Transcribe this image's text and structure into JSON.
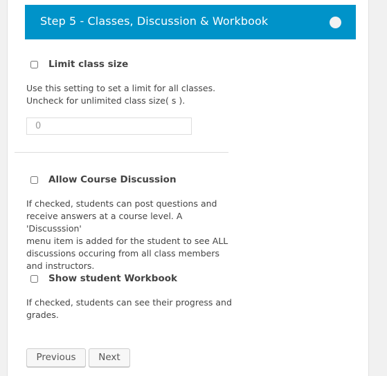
{
  "header": {
    "title": "Step 5 - Classes, Discussion & Workbook",
    "status_color": "#f2f2f2",
    "accent": "#0093c9"
  },
  "limit_class_size": {
    "label": "Limit class size",
    "checked": false,
    "description_line1": "Use this setting to set a limit for all classes.",
    "description_line2": "Uncheck for unlimited class size( s ).",
    "input_value": "0"
  },
  "allow_discussion": {
    "label": "Allow Course Discussion",
    "checked": false,
    "description_lines": [
      "If checked, students can post questions and",
      "receive answers at a course level. A 'Discusssion'",
      "menu item is added for the student to see ALL",
      "discussions occuring from all class members",
      "and instructors."
    ]
  },
  "show_workbook": {
    "label": "Show student Workbook",
    "checked": false,
    "description_lines": [
      "If checked, students can see their progress and",
      "grades."
    ]
  },
  "buttons": {
    "previous": "Previous",
    "next": "Next"
  }
}
